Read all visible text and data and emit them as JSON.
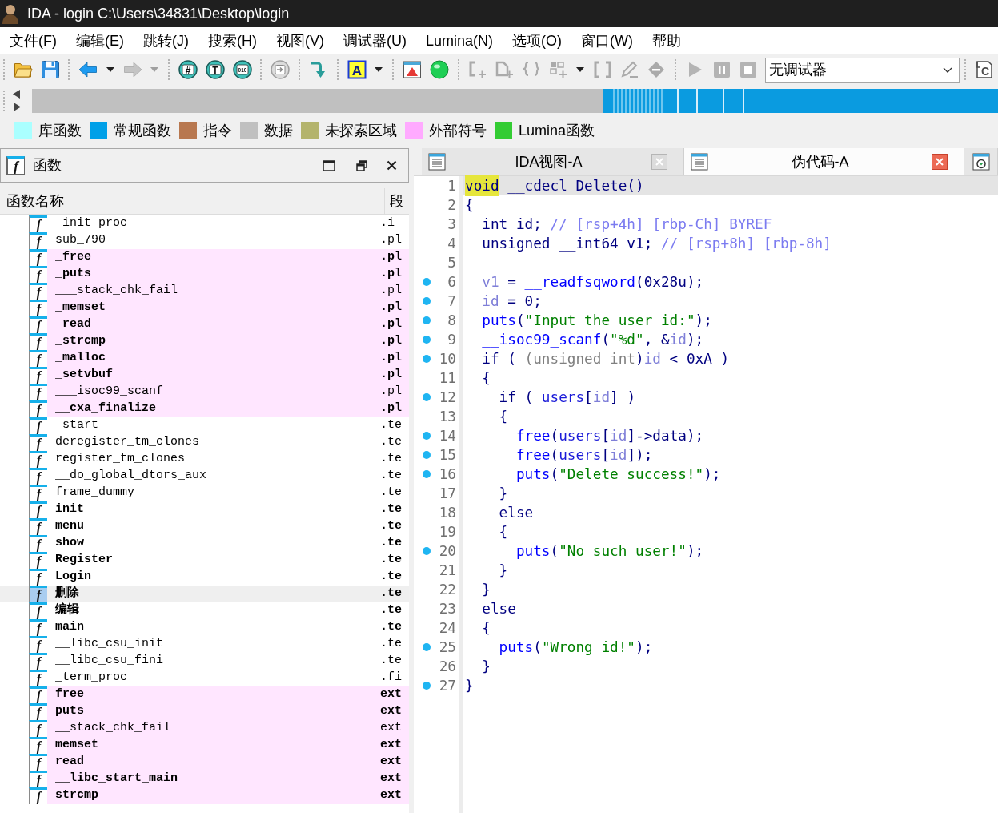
{
  "window": {
    "title": "IDA - login C:\\Users\\34831\\Desktop\\login"
  },
  "menu": [
    "文件(F)",
    "编辑(E)",
    "跳转(J)",
    "搜索(H)",
    "视图(V)",
    "调试器(U)",
    "Lumina(N)",
    "选项(O)",
    "窗口(W)",
    "帮助"
  ],
  "toolbar": {
    "groups": [
      [
        {
          "kind": "folder",
          "disabled": false
        },
        {
          "kind": "save",
          "disabled": false
        }
      ],
      [
        {
          "kind": "back",
          "disabled": false
        },
        {
          "kind": "caret",
          "disabled": false
        },
        {
          "kind": "forward",
          "disabled": true
        },
        {
          "kind": "caret",
          "disabled": true
        }
      ],
      [
        {
          "kind": "roundel",
          "glyph": "#",
          "disabled": false
        },
        {
          "kind": "roundel",
          "glyph": "T",
          "disabled": false
        },
        {
          "kind": "roundel",
          "glyph": "010",
          "disabled": false
        }
      ],
      [
        {
          "kind": "jump",
          "disabled": true
        }
      ],
      [
        {
          "kind": "bend",
          "disabled": false
        }
      ],
      [
        {
          "kind": "lettertile",
          "glyph": "A",
          "disabled": false
        },
        {
          "kind": "caret",
          "disabled": false
        }
      ],
      [
        {
          "kind": "window",
          "disabled": false
        },
        {
          "kind": "orb",
          "disabled": false
        }
      ],
      [
        {
          "kind": "bracket",
          "disabled": true
        },
        {
          "kind": "page",
          "disabled": true
        },
        {
          "kind": "braces",
          "disabled": true
        },
        {
          "kind": "blocks",
          "disabled": true
        },
        {
          "kind": "caret",
          "disabled": false
        },
        {
          "kind": "frame",
          "disabled": true
        },
        {
          "kind": "pencil",
          "disabled": true
        },
        {
          "kind": "diamond",
          "disabled": true
        }
      ],
      [
        {
          "kind": "play",
          "disabled": true
        },
        {
          "kind": "pause",
          "disabled": true
        },
        {
          "kind": "stop",
          "disabled": true
        },
        {
          "kind": "dropdown",
          "value": "无调试器"
        }
      ],
      [
        {
          "kind": "cornertile",
          "glyph": "C",
          "disabled": false
        }
      ]
    ]
  },
  "legend": [
    {
      "label": "库函数",
      "color": "#aaffff"
    },
    {
      "label": "常规函数",
      "color": "#00a0e8"
    },
    {
      "label": "指令",
      "color": "#b87850"
    },
    {
      "label": "数据",
      "color": "#c0c0c0"
    },
    {
      "label": "未探索区域",
      "color": "#b4b46c"
    },
    {
      "label": "外部符号",
      "color": "#ffaaff"
    },
    {
      "label": "Lumina函数",
      "color": "#33cc33"
    }
  ],
  "functions_panel": {
    "title": "函数",
    "glyph": "f",
    "columns": [
      "函数名称",
      "段"
    ],
    "rows": [
      {
        "glyph": "f",
        "name": "_init_proc",
        "segment": ".i",
        "bold": false,
        "external": false,
        "selected": false
      },
      {
        "glyph": "f",
        "name": "sub_790",
        "segment": ".pl",
        "bold": false,
        "external": false,
        "selected": false
      },
      {
        "glyph": "f",
        "name": "_free",
        "segment": ".pl",
        "bold": true,
        "external": true,
        "selected": false
      },
      {
        "glyph": "f",
        "name": "_puts",
        "segment": ".pl",
        "bold": true,
        "external": true,
        "selected": false
      },
      {
        "glyph": "f",
        "name": "___stack_chk_fail",
        "segment": ".pl",
        "bold": false,
        "external": true,
        "selected": false
      },
      {
        "glyph": "f",
        "name": "_memset",
        "segment": ".pl",
        "bold": true,
        "external": true,
        "selected": false
      },
      {
        "glyph": "f",
        "name": "_read",
        "segment": ".pl",
        "bold": true,
        "external": true,
        "selected": false
      },
      {
        "glyph": "f",
        "name": "_strcmp",
        "segment": ".pl",
        "bold": true,
        "external": true,
        "selected": false
      },
      {
        "glyph": "f",
        "name": "_malloc",
        "segment": ".pl",
        "bold": true,
        "external": true,
        "selected": false
      },
      {
        "glyph": "f",
        "name": "_setvbuf",
        "segment": ".pl",
        "bold": true,
        "external": true,
        "selected": false
      },
      {
        "glyph": "f",
        "name": "___isoc99_scanf",
        "segment": ".pl",
        "bold": false,
        "external": true,
        "selected": false
      },
      {
        "glyph": "f",
        "name": "__cxa_finalize",
        "segment": ".pl",
        "bold": true,
        "external": true,
        "selected": false
      },
      {
        "glyph": "f",
        "name": "_start",
        "segment": ".te",
        "bold": false,
        "external": false,
        "selected": false
      },
      {
        "glyph": "f",
        "name": "deregister_tm_clones",
        "segment": ".te",
        "bold": false,
        "external": false,
        "selected": false
      },
      {
        "glyph": "f",
        "name": "register_tm_clones",
        "segment": ".te",
        "bold": false,
        "external": false,
        "selected": false
      },
      {
        "glyph": "f",
        "name": "__do_global_dtors_aux",
        "segment": ".te",
        "bold": false,
        "external": false,
        "selected": false
      },
      {
        "glyph": "f",
        "name": "frame_dummy",
        "segment": ".te",
        "bold": false,
        "external": false,
        "selected": false
      },
      {
        "glyph": "f",
        "name": "init",
        "segment": ".te",
        "bold": true,
        "external": false,
        "selected": false
      },
      {
        "glyph": "f",
        "name": "menu",
        "segment": ".te",
        "bold": true,
        "external": false,
        "selected": false
      },
      {
        "glyph": "f",
        "name": "show",
        "segment": ".te",
        "bold": true,
        "external": false,
        "selected": false
      },
      {
        "glyph": "f",
        "name": "Register",
        "segment": ".te",
        "bold": true,
        "external": false,
        "selected": false
      },
      {
        "glyph": "f",
        "name": "Login",
        "segment": ".te",
        "bold": true,
        "external": false,
        "selected": false
      },
      {
        "glyph": "f",
        "name": "删除",
        "segment": ".te",
        "bold": true,
        "external": false,
        "selected": true
      },
      {
        "glyph": "f",
        "name": "编辑",
        "segment": ".te",
        "bold": true,
        "external": false,
        "selected": false
      },
      {
        "glyph": "f",
        "name": "main",
        "segment": ".te",
        "bold": true,
        "external": false,
        "selected": false
      },
      {
        "glyph": "f",
        "name": "__libc_csu_init",
        "segment": ".te",
        "bold": false,
        "external": false,
        "selected": false
      },
      {
        "glyph": "f",
        "name": "__libc_csu_fini",
        "segment": ".te",
        "bold": false,
        "external": false,
        "selected": false
      },
      {
        "glyph": "f",
        "name": "_term_proc",
        "segment": ".fi",
        "bold": false,
        "external": false,
        "selected": false
      },
      {
        "glyph": "f",
        "name": "free",
        "segment": "ext",
        "bold": true,
        "external": true,
        "selected": false
      },
      {
        "glyph": "f",
        "name": "puts",
        "segment": "ext",
        "bold": true,
        "external": true,
        "selected": false
      },
      {
        "glyph": "f",
        "name": "__stack_chk_fail",
        "segment": "ext",
        "bold": false,
        "external": true,
        "selected": false
      },
      {
        "glyph": "f",
        "name": "memset",
        "segment": "ext",
        "bold": true,
        "external": true,
        "selected": false
      },
      {
        "glyph": "f",
        "name": "read",
        "segment": "ext",
        "bold": true,
        "external": true,
        "selected": false
      },
      {
        "glyph": "f",
        "name": "__libc_start_main",
        "segment": "ext",
        "bold": true,
        "external": true,
        "selected": false
      },
      {
        "glyph": "f",
        "name": "strcmp",
        "segment": "ext",
        "bold": true,
        "external": true,
        "selected": false
      }
    ]
  },
  "tabs": [
    {
      "label": "IDA视图-A",
      "selected": false
    },
    {
      "label": "伪代码-A",
      "selected": true
    },
    {
      "selected": false
    }
  ],
  "pseudocode": {
    "lines": [
      {
        "number": "1",
        "marker": false,
        "current": true,
        "tokens": [
          {
            "text": "void",
            "kind": "highlighted"
          },
          {
            "text": " __cdecl Delete()",
            "kind": "plain"
          }
        ]
      },
      {
        "number": "2",
        "marker": false,
        "current": false,
        "tokens": [
          {
            "text": "{",
            "kind": "plain"
          }
        ]
      },
      {
        "number": "3",
        "marker": false,
        "current": false,
        "tokens": [
          {
            "text": "  int id; ",
            "kind": "plain"
          },
          {
            "text": "// [rsp+4h] [rbp-Ch] BYREF",
            "kind": "comment"
          }
        ]
      },
      {
        "number": "4",
        "marker": false,
        "current": false,
        "tokens": [
          {
            "text": "  unsigned __int64 v1; ",
            "kind": "plain"
          },
          {
            "text": "// [rsp+8h] [rbp-8h]",
            "kind": "comment"
          }
        ]
      },
      {
        "number": "5",
        "marker": false,
        "current": false
      },
      {
        "number": "6",
        "marker": true,
        "current": false,
        "tokens": [
          {
            "text": "  v1",
            "kind": "local"
          },
          {
            "text": " = ",
            "kind": "plain"
          },
          {
            "text": "__readfsqword",
            "kind": "call"
          },
          {
            "text": "(0x28u);",
            "kind": "plain"
          }
        ]
      },
      {
        "number": "7",
        "marker": true,
        "current": false,
        "tokens": [
          {
            "text": "  id",
            "kind": "local"
          },
          {
            "text": " = 0;",
            "kind": "plain"
          }
        ]
      },
      {
        "number": "8",
        "marker": true,
        "current": false,
        "tokens": [
          {
            "text": "  puts",
            "kind": "call"
          },
          {
            "text": "(",
            "kind": "plain"
          },
          {
            "text": "\"Input the user id:\"",
            "kind": "string"
          },
          {
            "text": ");",
            "kind": "plain"
          }
        ]
      },
      {
        "number": "9",
        "marker": true,
        "current": false,
        "tokens": [
          {
            "text": "  __isoc99_scanf",
            "kind": "call"
          },
          {
            "text": "(",
            "kind": "plain"
          },
          {
            "text": "\"%d\"",
            "kind": "string"
          },
          {
            "text": ", &",
            "kind": "plain"
          },
          {
            "text": "id",
            "kind": "local"
          },
          {
            "text": ");",
            "kind": "plain"
          }
        ]
      },
      {
        "number": "10",
        "marker": true,
        "current": false,
        "tokens": [
          {
            "text": "  if ( ",
            "kind": "plain"
          },
          {
            "text": "(unsigned int",
            "kind": "cast"
          },
          {
            "text": ")",
            "kind": "plain"
          },
          {
            "text": "id",
            "kind": "local"
          },
          {
            "text": " < 0xA )",
            "kind": "plain"
          }
        ]
      },
      {
        "number": "11",
        "marker": false,
        "current": false,
        "tokens": [
          {
            "text": "  {",
            "kind": "plain"
          }
        ]
      },
      {
        "number": "12",
        "marker": true,
        "current": false,
        "tokens": [
          {
            "text": "    if ( ",
            "kind": "plain"
          },
          {
            "text": "users",
            "kind": "global"
          },
          {
            "text": "[",
            "kind": "plain"
          },
          {
            "text": "id",
            "kind": "local"
          },
          {
            "text": "] )",
            "kind": "plain"
          }
        ]
      },
      {
        "number": "13",
        "marker": false,
        "current": false,
        "tokens": [
          {
            "text": "    {",
            "kind": "plain"
          }
        ]
      },
      {
        "number": "14",
        "marker": true,
        "current": false,
        "tokens": [
          {
            "text": "      free",
            "kind": "call"
          },
          {
            "text": "(",
            "kind": "plain"
          },
          {
            "text": "users",
            "kind": "global"
          },
          {
            "text": "[",
            "kind": "plain"
          },
          {
            "text": "id",
            "kind": "local"
          },
          {
            "text": "]->data);",
            "kind": "plain"
          }
        ]
      },
      {
        "number": "15",
        "marker": true,
        "current": false,
        "tokens": [
          {
            "text": "      free",
            "kind": "call"
          },
          {
            "text": "(",
            "kind": "plain"
          },
          {
            "text": "users",
            "kind": "global"
          },
          {
            "text": "[",
            "kind": "plain"
          },
          {
            "text": "id",
            "kind": "local"
          },
          {
            "text": "]);",
            "kind": "plain"
          }
        ]
      },
      {
        "number": "16",
        "marker": true,
        "current": false,
        "tokens": [
          {
            "text": "      puts",
            "kind": "call"
          },
          {
            "text": "(",
            "kind": "plain"
          },
          {
            "text": "\"Delete success!\"",
            "kind": "string"
          },
          {
            "text": ");",
            "kind": "plain"
          }
        ]
      },
      {
        "number": "17",
        "marker": false,
        "current": false,
        "tokens": [
          {
            "text": "    }",
            "kind": "plain"
          }
        ]
      },
      {
        "number": "18",
        "marker": false,
        "current": false,
        "tokens": [
          {
            "text": "    else",
            "kind": "plain"
          }
        ]
      },
      {
        "number": "19",
        "marker": false,
        "current": false,
        "tokens": [
          {
            "text": "    {",
            "kind": "plain"
          }
        ]
      },
      {
        "number": "20",
        "marker": true,
        "current": false,
        "tokens": [
          {
            "text": "      puts",
            "kind": "call"
          },
          {
            "text": "(",
            "kind": "plain"
          },
          {
            "text": "\"No such user!\"",
            "kind": "string"
          },
          {
            "text": ");",
            "kind": "plain"
          }
        ]
      },
      {
        "number": "21",
        "marker": false,
        "current": false,
        "tokens": [
          {
            "text": "    }",
            "kind": "plain"
          }
        ]
      },
      {
        "number": "22",
        "marker": false,
        "current": false,
        "tokens": [
          {
            "text": "  }",
            "kind": "plain"
          }
        ]
      },
      {
        "number": "23",
        "marker": false,
        "current": false,
        "tokens": [
          {
            "text": "  else",
            "kind": "plain"
          }
        ]
      },
      {
        "number": "24",
        "marker": false,
        "current": false,
        "tokens": [
          {
            "text": "  {",
            "kind": "plain"
          }
        ]
      },
      {
        "number": "25",
        "marker": true,
        "current": false,
        "tokens": [
          {
            "text": "    puts",
            "kind": "call"
          },
          {
            "text": "(",
            "kind": "plain"
          },
          {
            "text": "\"Wrong id!\"",
            "kind": "string"
          },
          {
            "text": ");",
            "kind": "plain"
          }
        ]
      },
      {
        "number": "26",
        "marker": false,
        "current": false,
        "tokens": [
          {
            "text": "  }",
            "kind": "plain"
          }
        ]
      },
      {
        "number": "27",
        "marker": true,
        "current": false,
        "tokens": [
          {
            "text": "}",
            "kind": "plain"
          }
        ]
      }
    ]
  }
}
